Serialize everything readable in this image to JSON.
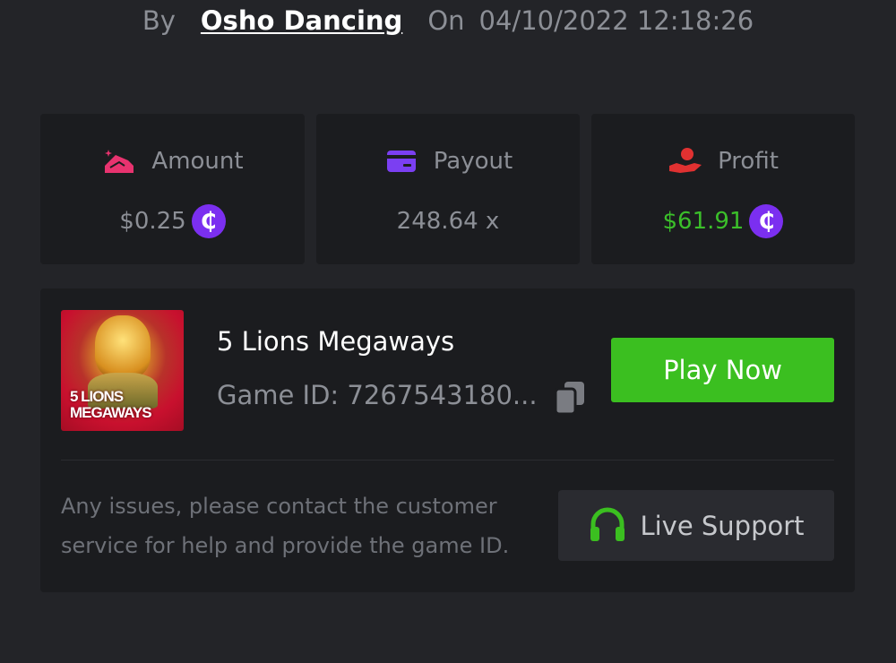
{
  "byline": {
    "by_label": "By",
    "user": "Osho Dancing",
    "on_label": "On",
    "datetime": "04/10/2022 12:18:26"
  },
  "stats": {
    "amount": {
      "label": "Amount",
      "value": "$0.25",
      "icon": "amount-icon",
      "coin": "₵"
    },
    "payout": {
      "label": "Payout",
      "value": "248.64 x",
      "icon": "card-icon"
    },
    "profit": {
      "label": "Profit",
      "value": "$61.91",
      "icon": "hand-coin-icon",
      "coin": "₵"
    }
  },
  "game": {
    "thumbnail_text_line1": "5 LIONS",
    "thumbnail_text_line2": "MEGAWAYS",
    "name": "5 Lions Megaways",
    "id_text": "Game ID: 7267543180..."
  },
  "buttons": {
    "play": "Play Now",
    "support": "Live Support"
  },
  "help_text": "Any issues, please contact the customer service for help and provide the game ID.",
  "colors": {
    "background": "#232428",
    "card": "#1b1c1f",
    "accent_green": "#3bbf20",
    "coin_purple": "#7b2ff0",
    "amount_icon": "#e8336f",
    "payout_icon": "#7b3ff2",
    "profit_icon": "#e03131"
  }
}
